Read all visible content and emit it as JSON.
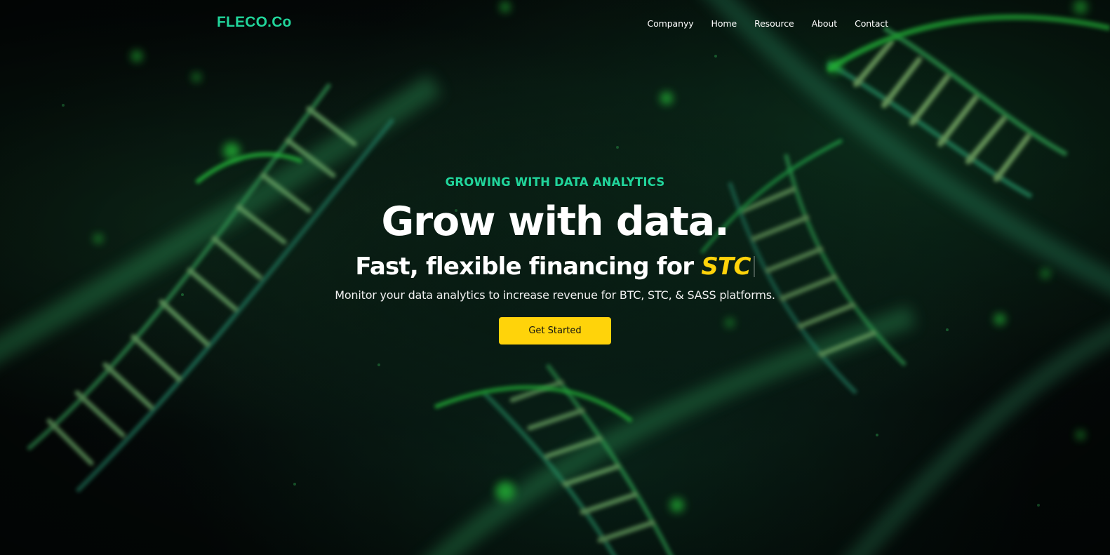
{
  "brand": {
    "logo_text": "FLECO.Co"
  },
  "nav": {
    "links": [
      {
        "label": "Companyy"
      },
      {
        "label": "Home"
      },
      {
        "label": "Resource"
      },
      {
        "label": "About"
      },
      {
        "label": "Contact"
      }
    ]
  },
  "hero": {
    "eyebrow": "GROWING WITH DATA ANALYTICS",
    "headline": "Grow with data.",
    "subhead_prefix": "Fast, flexible financing for ",
    "subhead_highlight": "STC",
    "description": "Monitor your data analytics to increase revenue for BTC, STC, & SASS platforms.",
    "cta_label": "Get Started"
  },
  "colors": {
    "accent_green": "#21d59b",
    "highlight_yellow": "#ffd30a",
    "button_yellow": "#ffd30a",
    "background_dark": "#050b0a"
  },
  "background": {
    "icon": "dna-helix-background-image"
  }
}
